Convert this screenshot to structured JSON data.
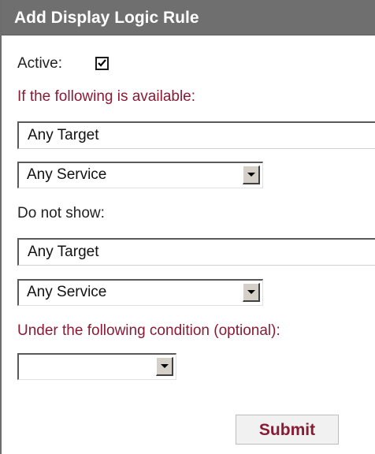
{
  "form": {
    "title": "Add Display Logic Rule",
    "active_label": "Active:",
    "active_checked": true,
    "available_label": "If the following is available:",
    "available_target": "Any Target",
    "available_service": "Any Service",
    "hide_label": "Do not show:",
    "hide_target": "Any Target",
    "hide_service": "Any Service",
    "condition_label": "Under the following condition (optional):",
    "condition_value": "",
    "submit_label": "Submit"
  },
  "colors": {
    "header_bg": "#6f6f6f",
    "header_text": "#ffffff",
    "label_accent": "#8a1b35",
    "label_dark": "#222222"
  },
  "icons": {
    "checkbox": "checkmark-icon",
    "dropdown": "dropdown-arrow-icon"
  }
}
